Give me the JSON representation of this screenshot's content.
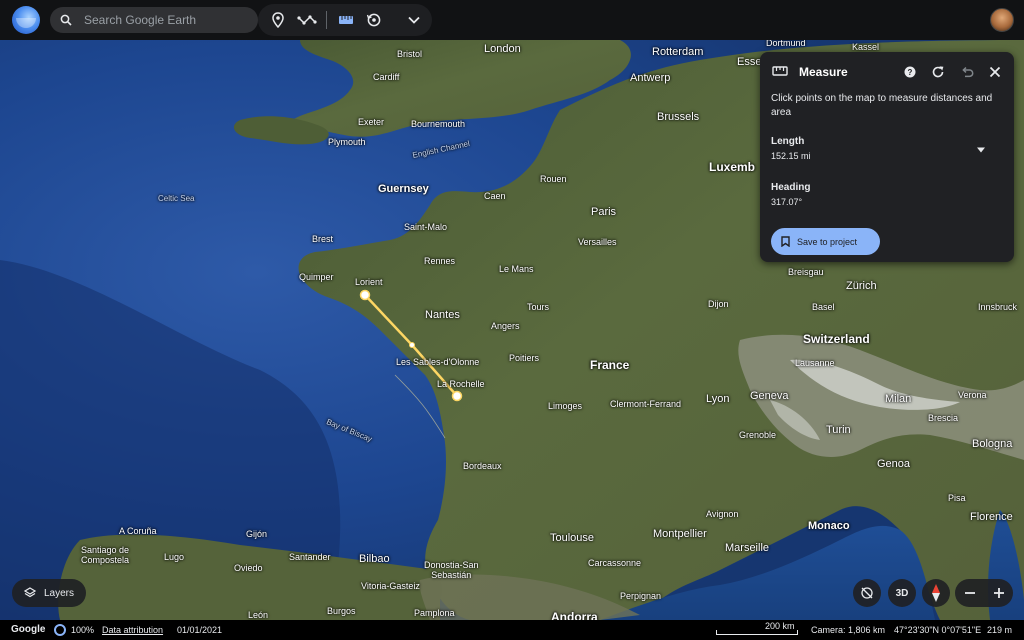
{
  "topbar": {
    "search_placeholder": "Search Google Earth",
    "icons": [
      "earth-logo",
      "search-icon",
      "place-marker-icon",
      "draw-path-icon",
      "ruler-icon",
      "history-icon",
      "chevron-down-icon",
      "account-avatar"
    ]
  },
  "map": {
    "labels": {
      "london": "London",
      "bristol": "Bristol",
      "cardiff": "Cardiff",
      "exeter": "Exeter",
      "bournemouth": "Bournemouth",
      "plymouth": "Plymouth",
      "english_channel": "English Channel",
      "celtic_sea": "Celtic Sea",
      "guernsey": "Guernsey",
      "caen": "Caen",
      "rouen": "Rouen",
      "saint_malo": "Saint-Malo",
      "brest": "Brest",
      "rennes": "Rennes",
      "paris": "Paris",
      "versailles": "Versailles",
      "quimper": "Quimper",
      "lorient": "Lorient",
      "le_mans": "Le Mans",
      "nantes": "Nantes",
      "angers": "Angers",
      "tours": "Tours",
      "les_sables": "Les Sables-d'Olonne",
      "poitiers": "Poitiers",
      "la_rochelle": "La Rochelle",
      "france": "France",
      "limoges": "Limoges",
      "clermont": "Clermont-Ferrand",
      "bay_of_biscay": "Bay of Biscay",
      "bordeaux": "Bordeaux",
      "toulouse": "Toulouse",
      "montpellier": "Montpellier",
      "marseille": "Marseille",
      "carcassonne": "Carcassonne",
      "avignon": "Avignon",
      "perpignan": "Perpignan",
      "andorra": "Andorra",
      "lyon": "Lyon",
      "grenoble": "Grenoble",
      "dijon": "Dijon",
      "geneva": "Geneva",
      "lausanne": "Lausanne",
      "switzerland": "Switzerland",
      "basel": "Basel",
      "zurich": "Zürich",
      "innsbruck": "Innsbruck",
      "milan": "Milan",
      "brescia": "Brescia",
      "verona": "Verona",
      "turin": "Turin",
      "bologna": "Bologna",
      "genoa": "Genoa",
      "pisa": "Pisa",
      "florence": "Florence",
      "monaco": "Monaco",
      "rotterdam": "Rotterdam",
      "antwerp": "Antwerp",
      "essen": "Essen",
      "brussels": "Brussels",
      "luxemb": "Luxemb",
      "dortmund": "Dortmund",
      "kassel": "Kassel",
      "breisgau": "Breisgau",
      "a_coruna": "A Coruña",
      "santiago": "Santiago de\nCompostela",
      "lugo": "Lugo",
      "oviedo": "Oviedo",
      "gijon": "Gijón",
      "santander": "Santander",
      "bilbao": "Bilbao",
      "donostia": "Donostia-San\nSebastián",
      "vitoria": "Vitoria-Gasteiz",
      "burgos": "Burgos",
      "pamplona": "Pamplona",
      "leon": "León"
    }
  },
  "measure_panel": {
    "title": "Measure",
    "description": "Click points on the map to measure distances and area",
    "length_label": "Length",
    "length_value": "152.15 mi",
    "heading_label": "Heading",
    "heading_value": "317.07°",
    "save_label": "Save to project"
  },
  "controls": {
    "layers_label": "Layers",
    "three_d_label": "3D"
  },
  "status": {
    "brand": "Google",
    "load_percent": "100%",
    "data_attribution": "Data attribution",
    "date": "01/01/2021",
    "scale": "200 km",
    "camera": "Camera: 1,806 km",
    "coordinates": "47°23'30\"N 0°07'51\"E",
    "elevation": "219 m"
  }
}
